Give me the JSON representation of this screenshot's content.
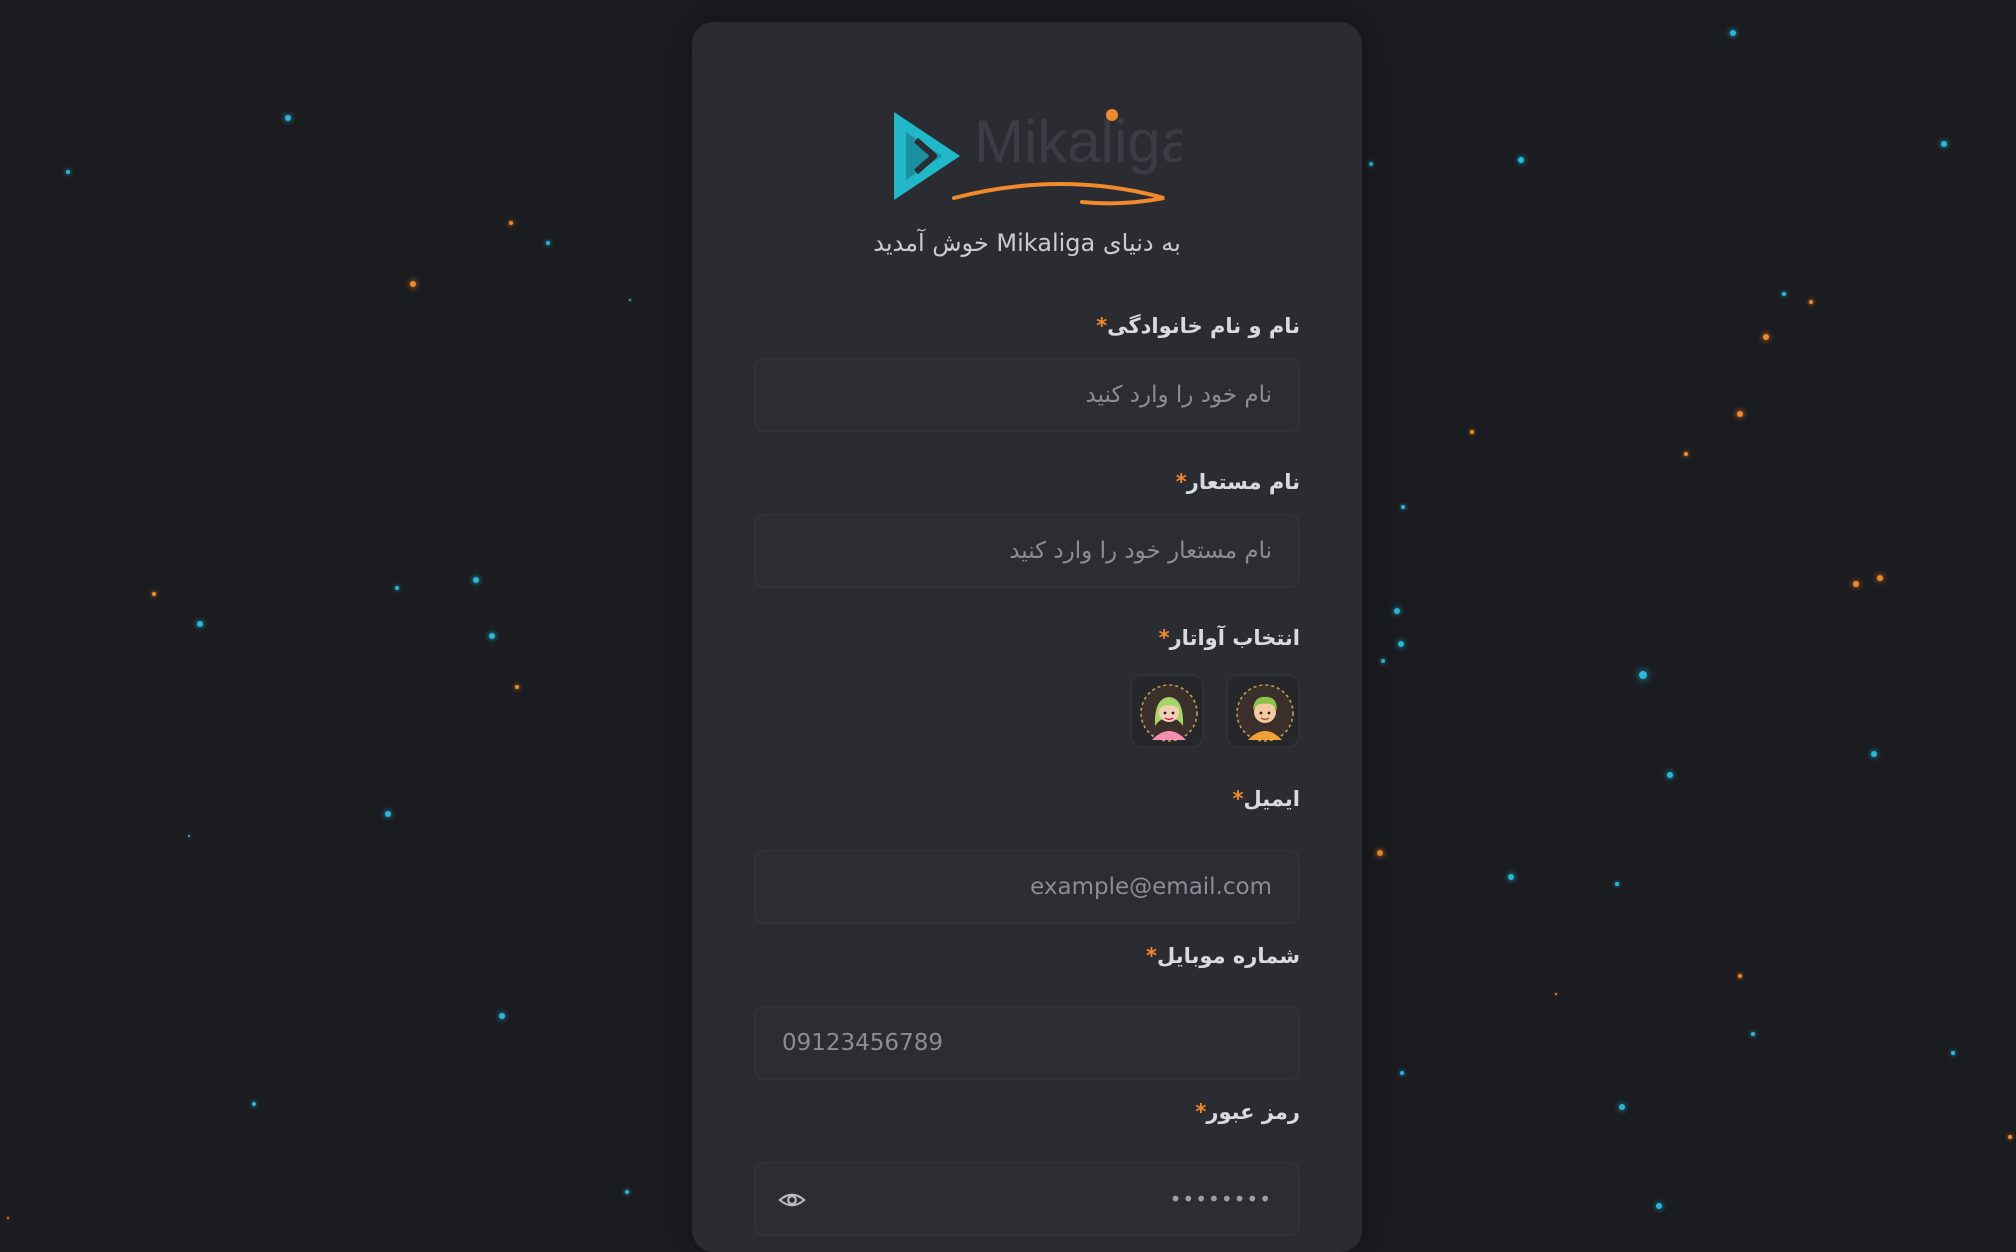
{
  "brand": {
    "name": "Mikaliga",
    "accent": "#f08a2c",
    "logo_color": "#22b7c9"
  },
  "welcome_text": "به دنیای Mikaliga خوش آمدید",
  "required_marker": "*",
  "form": {
    "full_name": {
      "label": "نام و نام خانوادگی",
      "placeholder": "نام خود را وارد کنید"
    },
    "nickname": {
      "label": "نام مستعار",
      "placeholder": "نام مستعار خود را وارد کنید"
    },
    "avatar": {
      "label": "انتخاب آواتار",
      "options": [
        "boy-avatar-icon",
        "girl-avatar-icon"
      ]
    },
    "email": {
      "label": "ایمیل",
      "placeholder": "example@email.com"
    },
    "mobile": {
      "label": "شماره موبایل",
      "placeholder": "09123456789"
    },
    "password": {
      "label": "رمز عبور",
      "masked_value": "••••••••",
      "toggle_icon": "eye-icon"
    }
  }
}
